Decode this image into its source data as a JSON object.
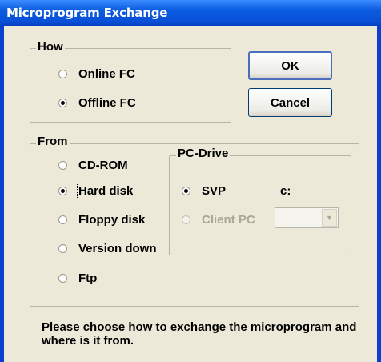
{
  "window": {
    "title": "Microprogram Exchange"
  },
  "how": {
    "label": "How",
    "options": [
      {
        "label": "Online FC",
        "checked": false
      },
      {
        "label": "Offline FC",
        "checked": true
      }
    ]
  },
  "buttons": {
    "ok": "OK",
    "cancel": "Cancel"
  },
  "from": {
    "label": "From",
    "options": [
      {
        "label": "CD-ROM",
        "checked": false
      },
      {
        "label": "Hard disk",
        "checked": true
      },
      {
        "label": "Floppy disk",
        "checked": false
      },
      {
        "label": "Version down",
        "checked": false
      },
      {
        "label": "Ftp",
        "checked": false
      }
    ]
  },
  "pc_drive": {
    "label": "PC-Drive",
    "svp_label": "SVP",
    "drive_letter": "c:",
    "client_label": "Client PC",
    "client_combo_value": ""
  },
  "help_text": "Please choose how to exchange the microprogram and where is it from."
}
